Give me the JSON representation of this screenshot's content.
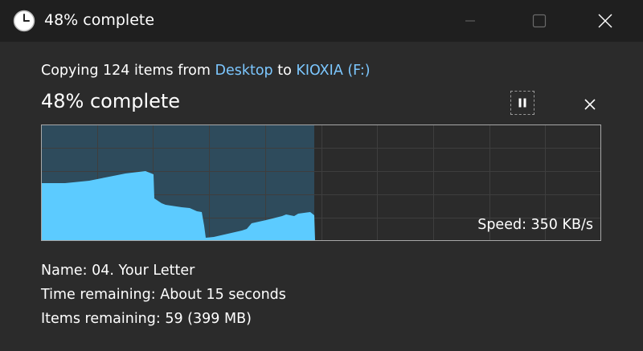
{
  "window": {
    "title": "48% complete",
    "title_icon": "clock-icon",
    "controls": {
      "minimize": "minimize-icon",
      "maximize": "maximize-icon",
      "close": "close-icon"
    }
  },
  "copy": {
    "prefix": "Copying 124 items from ",
    "source": "Desktop",
    "middle": " to ",
    "destination": "KIOXIA (F:)"
  },
  "progress": {
    "label": "48% complete",
    "percent": 48
  },
  "actions": {
    "pause": "pause-icon",
    "cancel": "close-icon"
  },
  "speed": {
    "text": "Speed: 350 KB/s"
  },
  "details": {
    "name_label": "Name: ",
    "name_value": "04. Your Letter",
    "time_label": "Time remaining: ",
    "time_value": "About 15 seconds",
    "items_label": "Items remaining: ",
    "items_value": "59 (399 MB)"
  },
  "colors": {
    "accent": "#7cc7ff",
    "graph_fill": "#5ccbff",
    "graph_done_bg": "#2e4b5c",
    "window_bg": "#2b2b2b",
    "titlebar_bg": "#1f1f1f"
  }
}
